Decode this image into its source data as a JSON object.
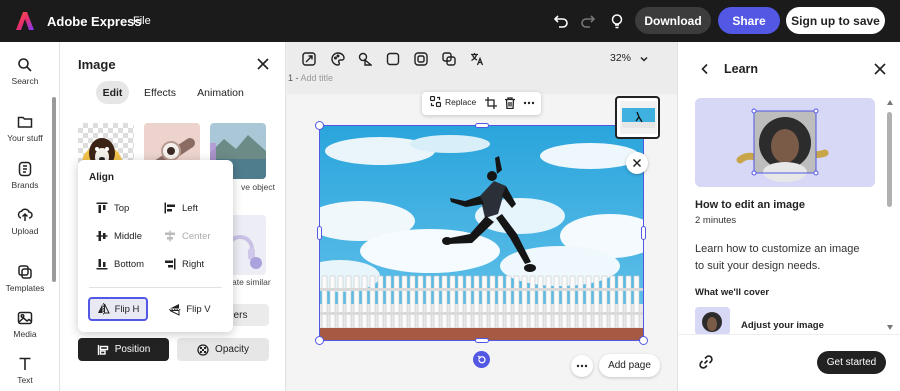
{
  "topbar": {
    "app_title": "Adobe Express",
    "file_menu": "File",
    "download": "Download",
    "share": "Share",
    "signup": "Sign up to save"
  },
  "rail": {
    "items": [
      {
        "label": "Search",
        "icon": "search-icon"
      },
      {
        "label": "Your stuff",
        "icon": "folder-icon"
      },
      {
        "label": "Brands",
        "icon": "brand-icon"
      },
      {
        "label": "Upload",
        "icon": "upload-icon"
      },
      {
        "label": "Templates",
        "icon": "templates-icon"
      },
      {
        "label": "Media",
        "icon": "media-icon"
      },
      {
        "label": "Text",
        "icon": "text-icon"
      }
    ]
  },
  "image_panel": {
    "title": "Image",
    "tabs": [
      "Edit",
      "Effects",
      "Animation"
    ],
    "active_tab": "Edit",
    "thumb_labels": [
      "ve object",
      "ate similar"
    ],
    "ghost_button": "ners",
    "position": "Position",
    "opacity": "Opacity"
  },
  "align": {
    "title": "Align",
    "top": "Top",
    "left": "Left",
    "middle": "Middle",
    "center": "Center",
    "bottom": "Bottom",
    "right": "Right",
    "flip_h": "Flip H",
    "flip_v": "Flip V"
  },
  "canvas": {
    "zoom": "32%",
    "page_number": "1 -",
    "page_title_placeholder": "Add title",
    "replace": "Replace",
    "add_page": "Add page"
  },
  "learn": {
    "title": "Learn",
    "lesson_title": "How to edit an image",
    "duration": "2 minutes",
    "description": "Learn how to customize an image to suit your design needs.",
    "cover_heading": "What we'll cover",
    "cover_item": "Adjust your image",
    "get_started": "Get started"
  },
  "colors": {
    "accent": "#5258e4",
    "topbar_bg": "#1b1b1b",
    "sky": "#3fb1e0"
  }
}
